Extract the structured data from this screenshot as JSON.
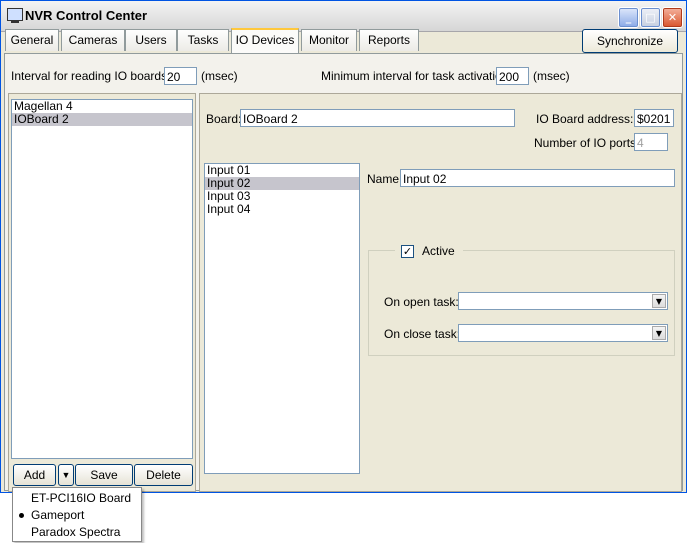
{
  "window": {
    "title": "NVR Control Center"
  },
  "tabs": [
    {
      "label": "General"
    },
    {
      "label": "Cameras"
    },
    {
      "label": "Users"
    },
    {
      "label": "Tasks"
    },
    {
      "label": "IO Devices"
    },
    {
      "label": "Monitor"
    },
    {
      "label": "Reports"
    }
  ],
  "active_tab": "IO Devices",
  "toolbar": {
    "synchronize_label": "Synchronize"
  },
  "settings": {
    "interval_label": "Interval for reading IO boards:",
    "interval_value": "20",
    "interval_unit": "(msec)",
    "min_interval_label": "Minimum interval for task activation:",
    "min_interval_value": "200",
    "min_interval_unit": "(msec)"
  },
  "boards_list": {
    "items": [
      "Magellan 4",
      "IOBoard 2"
    ],
    "selected": "IOBoard 2"
  },
  "board_details": {
    "board_label": "Board:",
    "board_value": "IOBoard 2",
    "address_label": "IO Board address:",
    "address_value": "$0201",
    "ports_label": "Number of IO ports:",
    "ports_value": "4"
  },
  "ports_list": {
    "items": [
      "Input 01",
      "Input 02",
      "Input 03",
      "Input 04"
    ],
    "selected": "Input 02"
  },
  "port_details": {
    "name_label": "Name:",
    "name_value": "Input 02",
    "active_label": "Active",
    "active_checked": true,
    "open_task_label": "On open task:",
    "open_task_value": "",
    "close_task_label": "On close task:",
    "close_task_value": ""
  },
  "board_buttons": {
    "add_label": "Add",
    "save_label": "Save",
    "delete_label": "Delete"
  },
  "add_menu": {
    "items": [
      "ET-PCI16IO Board",
      "Gameport",
      "Paradox Spectra"
    ],
    "selected": "Gameport"
  }
}
